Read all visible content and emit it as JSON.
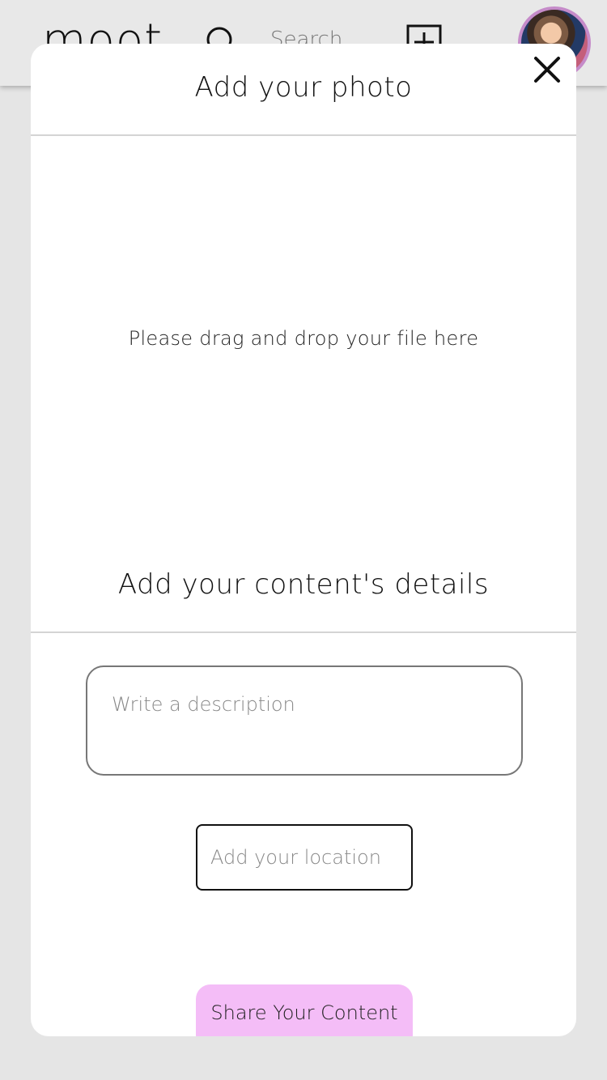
{
  "header": {
    "logo_text": "moot",
    "search_text": "Search",
    "icons": {
      "search": "search-icon",
      "add": "add-square-icon"
    }
  },
  "modal": {
    "photo_title": "Add your photo",
    "drop_text": "Please drag and drop your file here",
    "details_title": "Add your content's details",
    "description_placeholder": "Write a description",
    "location_placeholder": "Add your location",
    "share_label": "Share Your Content",
    "close_icon": "close-icon"
  },
  "colors": {
    "share_button": "#f4bdf7",
    "avatar_ring": "#c58bc9",
    "background": "#e5e5e5"
  }
}
